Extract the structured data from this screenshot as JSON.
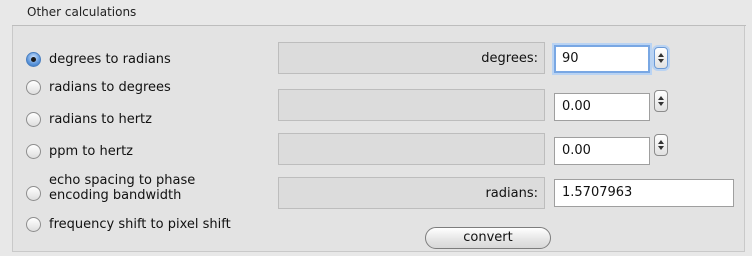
{
  "group": {
    "title": "Other calculations"
  },
  "options": [
    {
      "label": "degrees to radians",
      "selected": true
    },
    {
      "label": "radians to degrees",
      "selected": false
    },
    {
      "label": "radians to hertz",
      "selected": false
    },
    {
      "label": "ppm to hertz",
      "selected": false
    },
    {
      "label_line1": "echo spacing to phase",
      "label_line2": "encoding bandwidth",
      "selected": false
    },
    {
      "label": "frequency shift to pixel shift",
      "selected": false
    }
  ],
  "panels": [
    {
      "label": "degrees:"
    },
    {
      "label": ""
    },
    {
      "label": ""
    },
    {
      "label": "radians:"
    }
  ],
  "fields": {
    "input_value": "90",
    "field2_value": "0.00",
    "field3_value": "0.00",
    "output_value": "1.5707963"
  },
  "buttons": {
    "convert_label": "convert"
  },
  "colors": {
    "focus": "#79a7e3",
    "radio_selected": "#5d96db"
  }
}
